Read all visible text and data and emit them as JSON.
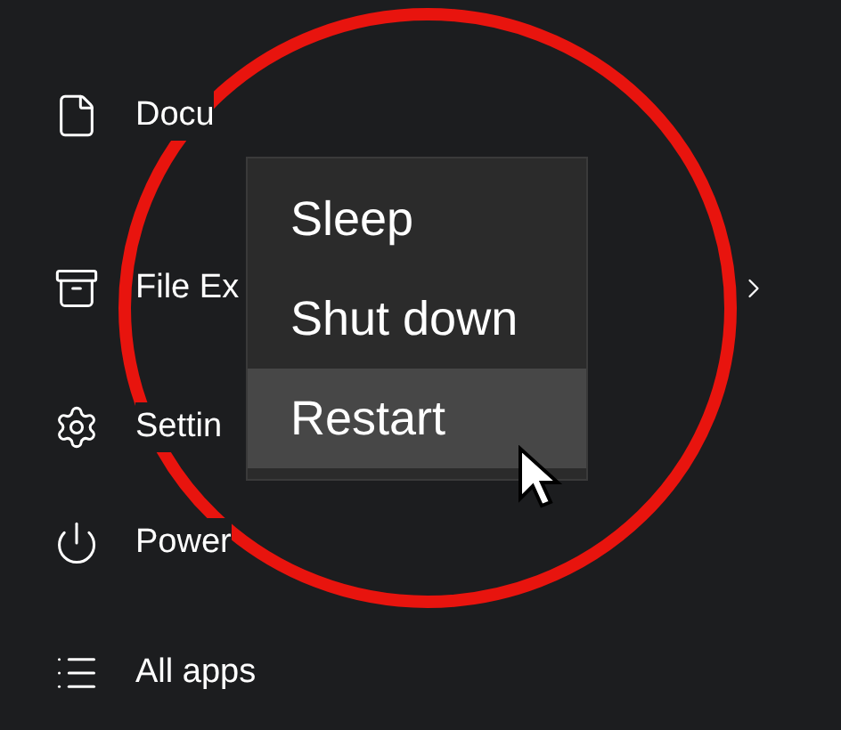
{
  "start_menu": {
    "items": [
      {
        "kind": "documents",
        "label": "Docu",
        "has_submenu": false
      },
      {
        "kind": "explorer",
        "label": "File Ex",
        "has_submenu": true
      },
      {
        "kind": "settings",
        "label": "Settin",
        "has_submenu": false
      },
      {
        "kind": "power",
        "label": "Power",
        "has_submenu": false
      },
      {
        "kind": "apps",
        "label": "All apps",
        "has_submenu": false
      }
    ]
  },
  "power_menu": {
    "items": [
      {
        "label": "Sleep",
        "selected": false
      },
      {
        "label": "Shut down",
        "selected": false
      },
      {
        "label": "Restart",
        "selected": true
      }
    ]
  },
  "annotation": {
    "color": "#e8140e"
  }
}
